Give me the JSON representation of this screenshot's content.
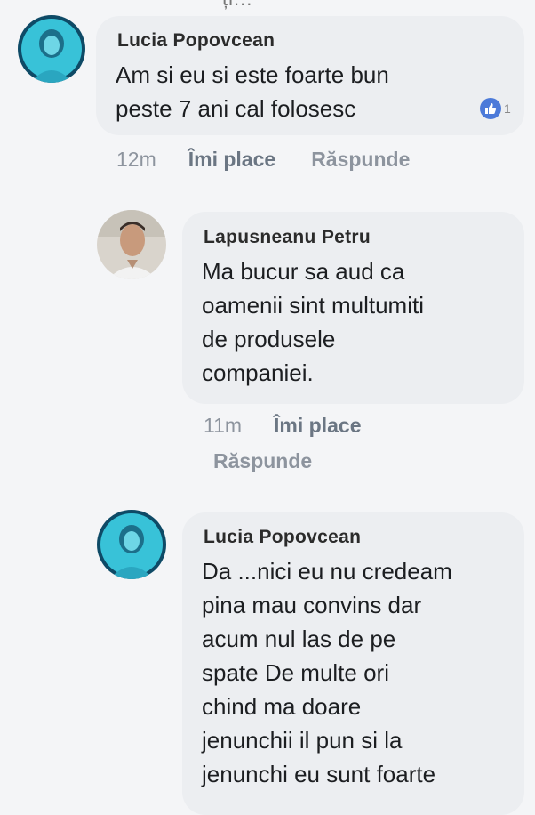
{
  "top_fragment": "ți...",
  "comments": [
    {
      "author": "Lucia  Popovcean",
      "text": "Am si eu si este foarte bun\npeste 7 ani cal folosesc",
      "time": "12m",
      "like_label": "Îmi place",
      "reply_label": "Răspunde",
      "reaction_count": "1",
      "reaction_icon": "thumbs-up-icon"
    },
    {
      "author": "Lapusneanu Petru",
      "text": "Ma bucur sa aud ca\noamenii sint multumiti\nde produsele\ncompaniei.",
      "time": "11m",
      "like_label": "Îmi place",
      "reply_label": "Răspunde"
    },
    {
      "author": "Lucia  Popovcean",
      "text": "Da ...nici eu nu credeam\npina mau convins dar\nacum nul las de pe\nspate  De multe ori\nchind ma doare\njenunchii il pun si la\njenunchi eu sunt foarte"
    }
  ],
  "colors": {
    "background": "#f4f5f7",
    "bubble": "#eceef1",
    "reaction_blue": "#4c7ad9",
    "avatar_teal": "#38c2d8"
  }
}
